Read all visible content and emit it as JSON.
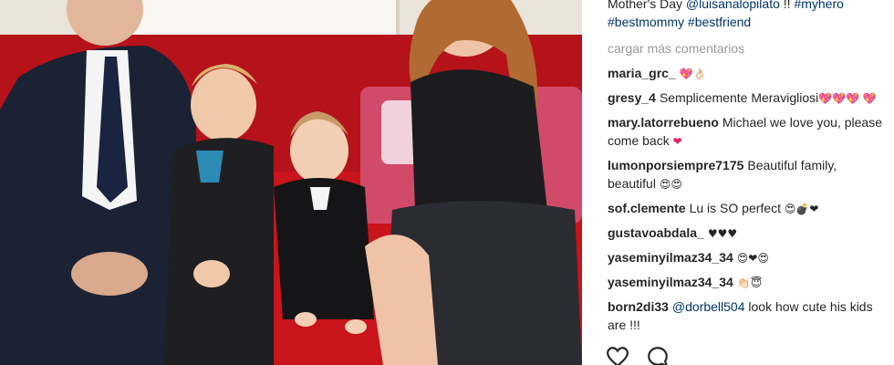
{
  "post": {
    "caption_line1": "Mother's Day ",
    "caption_mention": "@luisanalopilato",
    "caption_after_mention": " !! ",
    "caption_tag1": "#myhero",
    "caption_tag2": "#bestmommy",
    "caption_tag3": "#bestfriend"
  },
  "comments_header": {
    "load_more": "cargar más comentarios"
  },
  "comments": [
    {
      "user": "maria_grc_",
      "text": "",
      "emoji": "💖👌🏻"
    },
    {
      "user": "gresy_4",
      "text": "Semplicemente Meravigliosi",
      "emoji": "💖💖💖 💖"
    },
    {
      "user": "mary.latorrebueno",
      "text": "Michael we love you, please come back",
      "emoji": "❤"
    },
    {
      "user": "lumonporsiempre7175",
      "text": "Beautiful family, beautiful",
      "emoji": "😍😍"
    },
    {
      "user": "sof.clemente",
      "text": "Lu is SO perfect",
      "emoji": "😍💣❤"
    },
    {
      "user": "gustavoabdala_",
      "text": "",
      "emoji": "♥♥♥"
    },
    {
      "user": "yaseminyilmaz34_34",
      "text": "",
      "emoji": "😍❤😍"
    },
    {
      "user": "yaseminyilmaz34_34",
      "text": "",
      "emoji": "👏🏻😇"
    },
    {
      "user": "born2di33",
      "mention": "@dorbell504",
      "text": " look how cute his kids are !!!",
      "emoji": ""
    }
  ],
  "icons": {
    "like": "heart-outline-icon",
    "comment": "comment-bubble-icon"
  }
}
